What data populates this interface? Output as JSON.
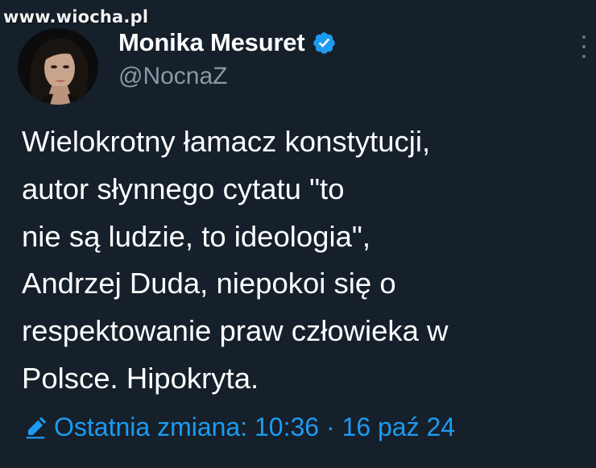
{
  "watermark": {
    "text": "www.wiocha.pl"
  },
  "author": {
    "display_name": "Monika Mesuret",
    "handle": "@NocnaZ",
    "verified": true,
    "verified_color": "#1d9bf0"
  },
  "tweet": {
    "lines": [
      "Wielokrotny łamacz konstytucji,",
      "autor słynnego cytatu \"to",
      "nie są ludzie, to ideologia\",",
      "Andrzej Duda, niepokoi się o",
      "respektowanie praw człowieka w",
      "Polsce. Hipokryta."
    ]
  },
  "edit_info": {
    "icon": "pencil-icon",
    "label": "Ostatnia zmiana: 10:36 · 16 paź 24",
    "color": "#1d9bf0"
  },
  "icons": {
    "more": "more-options-icon",
    "verified": "verified-badge-icon"
  },
  "theme": {
    "background": "#15202b",
    "text": "#ffffff",
    "secondary_text": "#8b98a5"
  }
}
